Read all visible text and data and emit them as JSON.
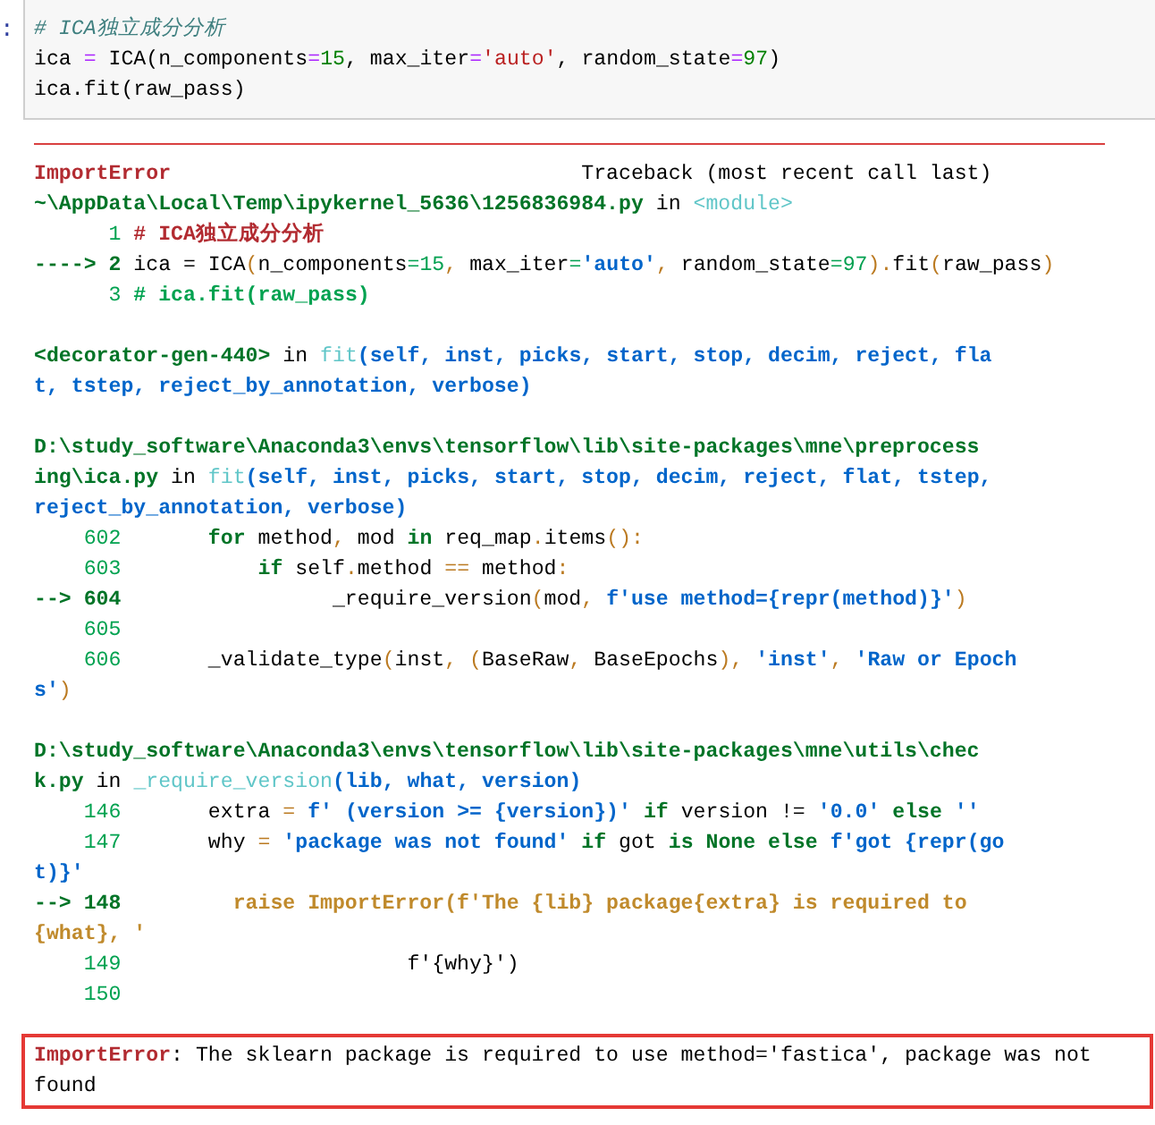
{
  "prompt": ":",
  "cell": {
    "lines": [
      [
        {
          "kind": "comment",
          "text": "# ICA独立成分分析"
        }
      ],
      [
        {
          "kind": "code",
          "text": "ica "
        },
        {
          "kind": "op",
          "text": "="
        },
        {
          "kind": "code",
          "text": " ICA(n_components"
        },
        {
          "kind": "op",
          "text": "="
        },
        {
          "kind": "number",
          "text": "15"
        },
        {
          "kind": "code",
          "text": ", max_iter"
        },
        {
          "kind": "op",
          "text": "="
        },
        {
          "kind": "string",
          "text": "'auto'"
        },
        {
          "kind": "code",
          "text": ", random_state"
        },
        {
          "kind": "op",
          "text": "="
        },
        {
          "kind": "number",
          "text": "97"
        },
        {
          "kind": "code",
          "text": ")"
        }
      ],
      [
        {
          "kind": "code",
          "text": "ica.fit(raw_pass)"
        }
      ]
    ]
  },
  "traceback": {
    "frames": [
      [
        [
          {
            "kind": "error",
            "text": "ImportError"
          },
          {
            "kind": "code",
            "text": "                                 Traceback (most recent call last)"
          }
        ],
        [
          {
            "kind": "file",
            "text": "~\\AppData\\Local\\Temp\\ipykernel_5636\\1256836984.py"
          },
          {
            "kind": "code",
            "text": " in "
          },
          {
            "kind": "func",
            "text": "<module>"
          }
        ],
        [
          {
            "kind": "lineno",
            "text": "      1 "
          },
          {
            "kind": "highlight",
            "text": "# ICA独立成分分析"
          }
        ],
        [
          {
            "kind": "arrow",
            "text": "----> 2 "
          },
          {
            "kind": "code",
            "text": "ica = ICA"
          },
          {
            "kind": "punct",
            "text": "("
          },
          {
            "kind": "code",
            "text": "n_components"
          },
          {
            "kind": "number",
            "text": "=15"
          },
          {
            "kind": "punct",
            "text": ", "
          },
          {
            "kind": "code",
            "text": "max_iter"
          },
          {
            "kind": "number",
            "text": "="
          },
          {
            "kind": "string",
            "text": "'auto'"
          },
          {
            "kind": "punct",
            "text": ", "
          },
          {
            "kind": "code",
            "text": "random_state"
          },
          {
            "kind": "number",
            "text": "=97"
          },
          {
            "kind": "punct",
            "text": ")."
          },
          {
            "kind": "code",
            "text": "fit"
          },
          {
            "kind": "punct",
            "text": "("
          },
          {
            "kind": "code",
            "text": "raw_pass"
          },
          {
            "kind": "punct",
            "text": ")"
          }
        ],
        [
          {
            "kind": "lineno",
            "text": "      3 "
          },
          {
            "kind": "context",
            "text": "# ica.fit(raw_pass)"
          }
        ]
      ],
      [
        [
          {
            "kind": "file",
            "text": "<decorator-gen-440>"
          },
          {
            "kind": "code",
            "text": " in "
          },
          {
            "kind": "func",
            "text": "fit"
          },
          {
            "kind": "args",
            "text": "(self, inst, picks, start, stop, decim, reject, fla"
          }
        ],
        [
          {
            "kind": "args",
            "text": "t, tstep, reject_by_annotation, verbose)"
          }
        ]
      ],
      [
        [
          {
            "kind": "file",
            "text": "D:\\study_software\\Anaconda3\\envs\\tensorflow\\lib\\site-packages\\mne\\preprocess"
          }
        ],
        [
          {
            "kind": "file",
            "text": "ing\\ica.py"
          },
          {
            "kind": "code",
            "text": " in "
          },
          {
            "kind": "func",
            "text": "fit"
          },
          {
            "kind": "args",
            "text": "(self, inst, picks, start, stop, decim, reject, flat, tstep,"
          }
        ],
        [
          {
            "kind": "args",
            "text": "reject_by_annotation, verbose)"
          }
        ],
        [
          {
            "kind": "lineno",
            "text": "    602       "
          },
          {
            "kind": "keyword",
            "text": "for"
          },
          {
            "kind": "code",
            "text": " method"
          },
          {
            "kind": "punct",
            "text": ","
          },
          {
            "kind": "code",
            "text": " mod "
          },
          {
            "kind": "keyword",
            "text": "in"
          },
          {
            "kind": "code",
            "text": " req_map"
          },
          {
            "kind": "punct",
            "text": "."
          },
          {
            "kind": "code",
            "text": "items"
          },
          {
            "kind": "punct",
            "text": "():"
          }
        ],
        [
          {
            "kind": "lineno",
            "text": "    603           "
          },
          {
            "kind": "keyword",
            "text": "if"
          },
          {
            "kind": "code",
            "text": " self"
          },
          {
            "kind": "punct",
            "text": "."
          },
          {
            "kind": "code",
            "text": "method "
          },
          {
            "kind": "punct",
            "text": "=="
          },
          {
            "kind": "code",
            "text": " method"
          },
          {
            "kind": "punct",
            "text": ":"
          }
        ],
        [
          {
            "kind": "arrow",
            "text": "--> 604"
          },
          {
            "kind": "code",
            "text": "                 _require_version"
          },
          {
            "kind": "punct",
            "text": "("
          },
          {
            "kind": "code",
            "text": "mod"
          },
          {
            "kind": "punct",
            "text": ", "
          },
          {
            "kind": "string",
            "text": "f'use method={repr(method)}'"
          },
          {
            "kind": "punct",
            "text": ")"
          }
        ],
        [
          {
            "kind": "lineno",
            "text": "    605"
          }
        ],
        [
          {
            "kind": "lineno",
            "text": "    606"
          },
          {
            "kind": "code",
            "text": "       _validate_type"
          },
          {
            "kind": "punct",
            "text": "("
          },
          {
            "kind": "code",
            "text": "inst"
          },
          {
            "kind": "punct",
            "text": ", ("
          },
          {
            "kind": "code",
            "text": "BaseRaw"
          },
          {
            "kind": "punct",
            "text": ", "
          },
          {
            "kind": "code",
            "text": "BaseEpochs"
          },
          {
            "kind": "punct",
            "text": "), "
          },
          {
            "kind": "string",
            "text": "'inst'"
          },
          {
            "kind": "punct",
            "text": ", "
          },
          {
            "kind": "string",
            "text": "'Raw or Epoch"
          }
        ],
        [
          {
            "kind": "string",
            "text": "s'"
          },
          {
            "kind": "punct",
            "text": ")"
          }
        ]
      ],
      [
        [
          {
            "kind": "file",
            "text": "D:\\study_software\\Anaconda3\\envs\\tensorflow\\lib\\site-packages\\mne\\utils\\chec"
          }
        ],
        [
          {
            "kind": "file",
            "text": "k.py"
          },
          {
            "kind": "code",
            "text": " in "
          },
          {
            "kind": "func",
            "text": "_require_version"
          },
          {
            "kind": "args",
            "text": "(lib, what, version)"
          }
        ],
        [
          {
            "kind": "lineno",
            "text": "    146"
          },
          {
            "kind": "code",
            "text": "       extra "
          },
          {
            "kind": "punct",
            "text": "="
          },
          {
            "kind": "string",
            "text": " f' (version >= {version})'"
          },
          {
            "kind": "keyword",
            "text": " if"
          },
          {
            "kind": "code",
            "text": " version != "
          },
          {
            "kind": "string",
            "text": "'0.0'"
          },
          {
            "kind": "keyword",
            "text": " else"
          },
          {
            "kind": "string",
            "text": " ''"
          }
        ],
        [
          {
            "kind": "lineno",
            "text": "    147"
          },
          {
            "kind": "code",
            "text": "       why "
          },
          {
            "kind": "punct",
            "text": "="
          },
          {
            "kind": "string",
            "text": " 'package was not found'"
          },
          {
            "kind": "keyword",
            "text": " if"
          },
          {
            "kind": "code",
            "text": " got "
          },
          {
            "kind": "keyword",
            "text": "is None else"
          },
          {
            "kind": "string",
            "text": " f'got {repr(go"
          }
        ],
        [
          {
            "kind": "string",
            "text": "t)}'"
          }
        ],
        [
          {
            "kind": "arrow",
            "text": "--> 148"
          },
          {
            "kind": "raise",
            "text": "         raise ImportError(f'The {lib} package{extra} is required to"
          }
        ],
        [
          {
            "kind": "raise",
            "text": "{what}, '"
          }
        ],
        [
          {
            "kind": "lineno",
            "text": "    149"
          },
          {
            "kind": "code",
            "text": "                       f'{why}')"
          }
        ],
        [
          {
            "kind": "lineno",
            "text": "    150"
          }
        ]
      ]
    ]
  },
  "error_box": {
    "lines": [
      [
        {
          "kind": "error",
          "text": "ImportError"
        },
        {
          "kind": "code",
          "text": ": The sklearn package is required to use method='fastica', package was not"
        }
      ],
      [
        {
          "kind": "code",
          "text": "found"
        }
      ]
    ]
  }
}
